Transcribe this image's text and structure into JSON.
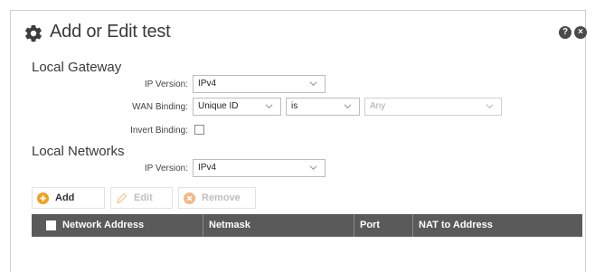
{
  "dialog": {
    "title": "Add or Edit test",
    "help_icon": "?",
    "close_icon": "×"
  },
  "local_gateway": {
    "section_title": "Local Gateway",
    "ip_version_label": "IP Version:",
    "ip_version_value": "IPv4",
    "wan_binding_label": "WAN Binding:",
    "wan_binding_value": "Unique ID",
    "wan_binding_operator": "is",
    "wan_binding_target": "Any",
    "invert_binding_label": "Invert Binding:",
    "invert_binding_checked": false
  },
  "local_networks": {
    "section_title": "Local Networks",
    "ip_version_label": "IP Version:",
    "ip_version_value": "IPv4"
  },
  "toolbar": {
    "add_label": "Add",
    "edit_label": "Edit",
    "remove_label": "Remove"
  },
  "table": {
    "columns": [
      "Network Address",
      "Netmask",
      "Port",
      "NAT to Address"
    ],
    "rows": []
  },
  "colors": {
    "add_icon": "#f0a020",
    "remove_icon": "#f4b88a",
    "table_header_bg": "#5a5a5a"
  }
}
